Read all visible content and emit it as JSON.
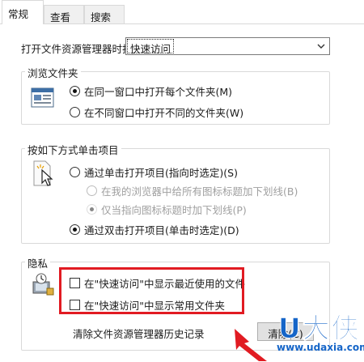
{
  "tabs": [
    {
      "label": "常规",
      "active": true
    },
    {
      "label": "查看",
      "active": false
    },
    {
      "label": "搜索",
      "active": false
    }
  ],
  "open_explorer": {
    "label": "打开文件资源管理器时打",
    "selected": "快速访问"
  },
  "browse_folders": {
    "title": "浏览文件夹",
    "options": [
      {
        "label": "在同一窗口中打开每个文件夹(M)",
        "checked": true,
        "disabled": false
      },
      {
        "label": "在不同窗口中打开不同的文件夹(W)",
        "checked": false,
        "disabled": false
      }
    ]
  },
  "click_items": {
    "title": "按如下方式单击项目",
    "options": [
      {
        "label": "通过单击打开项目(指向时选定)(S)",
        "checked": false,
        "disabled": false
      },
      {
        "label": "在我的浏览器中给所有图标标题加下划线(B)",
        "checked": false,
        "disabled": true
      },
      {
        "label": "仅当指向图标标题时加下划线(P)",
        "checked": true,
        "disabled": true
      },
      {
        "label": "通过双击打开项目(单击时选定)(D)",
        "checked": true,
        "disabled": false
      }
    ]
  },
  "privacy": {
    "title": "隐私",
    "checkboxes": [
      {
        "label": "在\"快速访问\"中显示最近使用的文件",
        "checked": false
      },
      {
        "label": "在\"快速访问\"中显示常用文件夹",
        "checked": false
      }
    ],
    "clear_history_label": "清除文件资源管理器历史记录",
    "clear_button": "清除(C)"
  },
  "watermark": {
    "logo": "U大侠",
    "url": "www.udaxia.com"
  },
  "colors": {
    "highlight_border": "#e11b22",
    "watermark": "#1565c8"
  }
}
